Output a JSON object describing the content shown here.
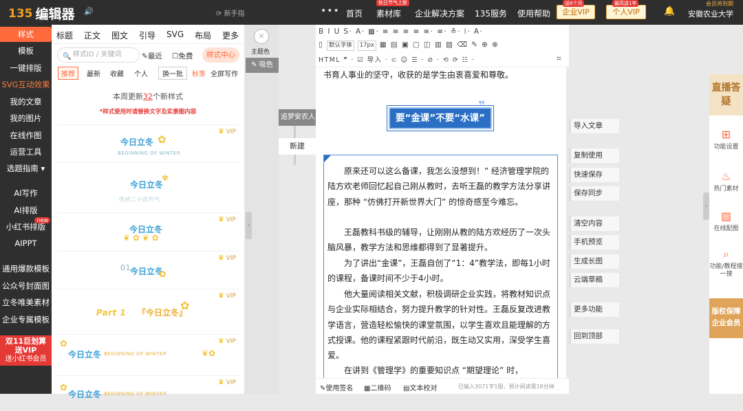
{
  "topbar": {
    "logo_mark": "135",
    "logo_text": "编辑器",
    "speaker": "🔊",
    "newbie_label": "新手指",
    "more": "•••",
    "nav": [
      {
        "label": "首页",
        "badge": ""
      },
      {
        "label": "素材库",
        "badge": "秋日节气上新"
      },
      {
        "label": "企业解决方案",
        "badge": ""
      },
      {
        "label": "135服务",
        "badge": ""
      },
      {
        "label": "使用帮助",
        "badge": ""
      }
    ],
    "vip_company": {
      "label": "企业VIP",
      "badge": "送6个月"
    },
    "vip_personal": {
      "label": "个人VIP",
      "badge": "最高送1年"
    },
    "user_tag": "会员将到期",
    "user_name": "安徽农业大学"
  },
  "sidebar": {
    "items": [
      "样式",
      "模板",
      "一键排版",
      "SVG互动效果",
      "我的文章",
      "我的图片",
      "在线作图",
      "运营工具",
      "选题指南",
      "AI写作",
      "AI排版",
      "小红书排版",
      "AIPPT",
      "通用爆款模板",
      "公众号封面图",
      "立冬唯美素材",
      "企业专属模板"
    ],
    "new_tag": "new",
    "dropdown": "▾",
    "promo_line1": "双11巨划算",
    "promo_line2": "送VIP",
    "promo_line3": "送小红书会员"
  },
  "panel": {
    "tabs": [
      "标题",
      "正文",
      "图文",
      "引导",
      "SVG",
      "布局",
      "更多"
    ],
    "search_placeholder": "样式ID / 关键词",
    "recent": "最近",
    "free": "免费",
    "style_center": "样式中心",
    "filters": [
      "推荐",
      "最新",
      "收藏",
      "个人"
    ],
    "swap": "换一批",
    "season": "秋季",
    "fullscreen": "全屏写作",
    "weekly_prefix": "本周更新",
    "weekly_count": "32",
    "weekly_suffix": "个新样式",
    "weekly_note": "*样式使用时请替换文字及实景图内容",
    "vip": "VIP",
    "cards": [
      {
        "title": "今日立冬",
        "sub": "BEGINNING OF WINTER"
      },
      {
        "title": "今日立冬",
        "sub": "传统二十四节气"
      },
      {
        "title": "今日立冬",
        "sub": ""
      },
      {
        "title": "今日立冬",
        "sub": "01"
      },
      {
        "title": "『今日立冬』",
        "sub": "Part 1"
      },
      {
        "title": "今日立冬",
        "sub": "BEGINNING OF WINTER"
      },
      {
        "title": "今日立冬",
        "sub": "BEGINNING OF WINTER"
      }
    ]
  },
  "graybar": {
    "theme_label": "主题色",
    "absorb_label": "吸色",
    "draft": "追梦安农人",
    "new": "新建"
  },
  "toolbar": {
    "row1": "B I U S· A· ▦· ≡ ≡ ≡ ≡ ≡· ≡· ≛· ⁞· A·",
    "font": "默认字体",
    "size": "17px",
    "row2": "▦ ▤ ▣ ▢ ◫ ▥ ▨ ⌫ ✎ ⊕ ⊗",
    "row3": "HTML ❞ · ☑ 导入 · ⊂ ☺ ☰ · ⊘ · ⟲ ⟳ ☷ ·",
    "expand": "⌗"
  },
  "editor": {
    "top_line": "书育人事业的坚守，收获的是学生由衷喜爱和尊敬。",
    "banner": "要“金课”不要“水课”",
    "paragraphs": [
      "原来还可以这么备课，我怎么没想到！” 经济管理学院的陆方欢老师回忆起自己刚从教时，去听王磊的教学方法分享讲座，那种 “仿佛打开新世界大门” 的惊奇感至今难忘。",
      "王磊教科书级的辅导，让刚刚从教的陆方欢经历了一次头脑风暴，教学方法和思维都得到了显著提升。",
      "为了讲出“金课”，王磊自创了“1：4”教学法，即每1小时的课程，备课时间不少于4小时。",
      "他大量阅读相关文献，积极调研企业实践，将教材知识点与企业实际相结合，努力提升教学的针对性。王磊反复改进教学语言，营造轻松愉快的课堂氛围，以学生喜欢且能理解的方式授课。他的课程紧跟时代前沿，既生动又实用，深受学生喜爱。",
      "在讲到《管理学》的重要知识点 “期望理论” 时，"
    ]
  },
  "statusbar": {
    "sign": "使用签名",
    "qr": "二维码",
    "proof": "文本校对",
    "count": "已输入3071字1图，预计阅读需18分钟"
  },
  "rightbtns": [
    "导入文章",
    "复制使用",
    "快速保存",
    "保存同步",
    "清空内容",
    "手机预览",
    "生成长图",
    "云端草稿",
    "更多功能",
    "回到顶部"
  ],
  "rpanel": {
    "live": "直播答疑",
    "tools": [
      {
        "icon": "⊞",
        "label": "功能设置"
      },
      {
        "icon": "♨",
        "label": "热门素材"
      },
      {
        "icon": "▧",
        "label": "在线配图"
      },
      {
        "icon": "⌕",
        "label": "功能/教程搜一搜"
      }
    ],
    "copyright": "版权保障企业会员"
  },
  "colors": {
    "accent": "#ff6a3d",
    "topbar": "#2e2e2e",
    "blue": "#2b6fc4"
  }
}
